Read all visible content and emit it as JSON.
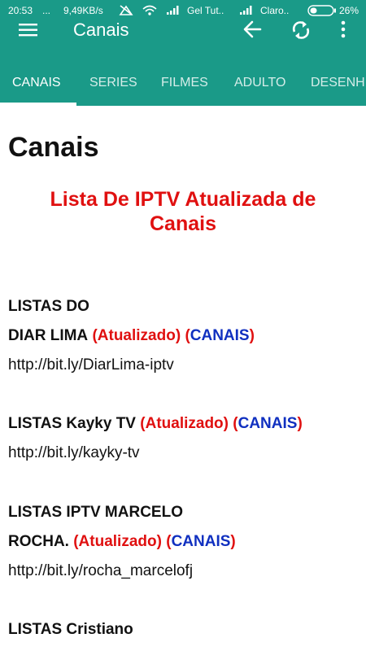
{
  "status_bar": {
    "time": "20:53",
    "dots": "...",
    "speed": "9,49KB/s",
    "carrier1": "Gel Tut..",
    "carrier2": "Claro..",
    "battery": "26%"
  },
  "app_bar": {
    "title": "Canais"
  },
  "tabs": [
    {
      "label": "CANAIS"
    },
    {
      "label": "SERIES"
    },
    {
      "label": "FILMES"
    },
    {
      "label": "ADULTO"
    },
    {
      "label": "DESENH"
    }
  ],
  "content": {
    "page_title": "Canais",
    "headline_line1": "Lista De IPTV Atualizada de",
    "headline_line2": "Canais",
    "entries": [
      {
        "name_line1": "LISTAS DO",
        "name_line2": "DIAR LIMA",
        "updated": "(Atualizado)",
        "open_paren": "(",
        "category": "CANAIS",
        "close_paren": ")",
        "url": "http://bit.ly/DiarLima-iptv"
      },
      {
        "name": "LISTAS Kayky TV",
        "updated": "(Atualizado)",
        "open_paren": "(",
        "category": "CANAIS",
        "close_paren": ")",
        "url": "http://bit.ly/kayky-tv"
      },
      {
        "name_line1": "LISTAS IPTV MARCELO",
        "name_line2": "ROCHA.",
        "updated": "(Atualizado)",
        "open_paren": "(",
        "category": "CANAIS",
        "close_paren": ")",
        "url": "http://bit.ly/rocha_marcelofj"
      },
      {
        "name": "LISTAS Cristiano"
      }
    ]
  }
}
